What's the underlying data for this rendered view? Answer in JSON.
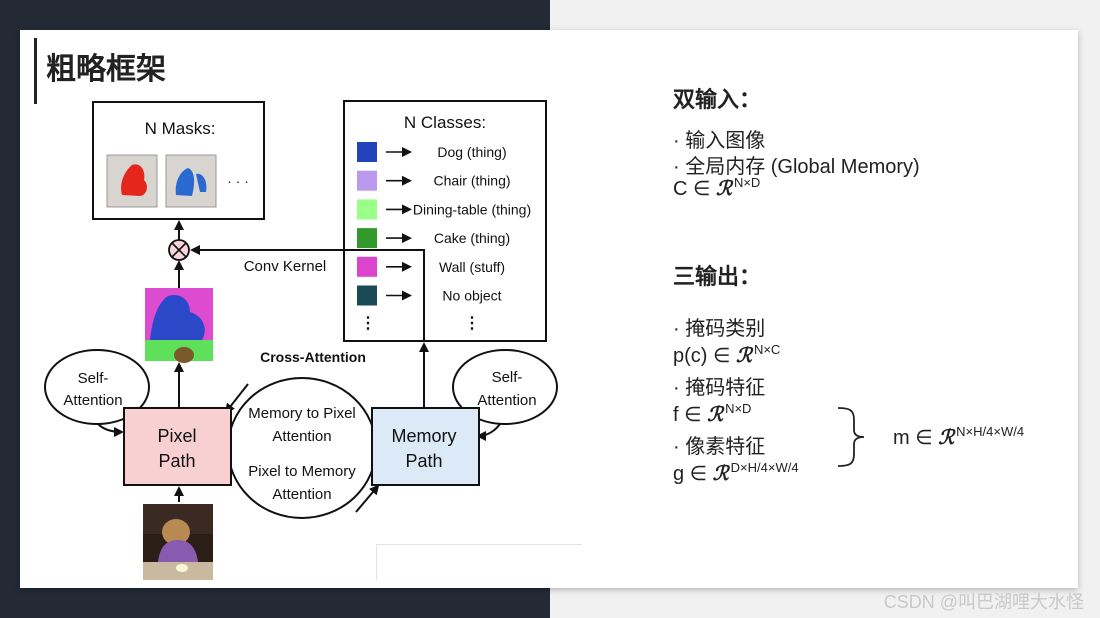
{
  "slide": {
    "title": "粗略框架"
  },
  "diagram": {
    "masks_title": "N Masks:",
    "masks_ellipsis": "· · ·",
    "classes_title": "N Classes:",
    "classes": [
      {
        "label": "Dog (thing)",
        "color": "#2244bb"
      },
      {
        "label": "Chair (thing)",
        "color": "#bb99ee"
      },
      {
        "label": "Dining-table (thing)",
        "color": "#99ff88"
      },
      {
        "label": "Cake (thing)",
        "color": "#33992a"
      },
      {
        "label": "Wall (stuff)",
        "color": "#dd44cc"
      },
      {
        "label": "No object",
        "color": "#1a4a55"
      }
    ],
    "conv_kernel": "Conv Kernel",
    "cross_attention": "Cross-Attention",
    "self_attention_left_1": "Self-",
    "self_attention_left_2": "Attention",
    "self_attention_right_1": "Self-",
    "self_attention_right_2": "Attention",
    "pixel_path_1": "Pixel",
    "pixel_path_2": "Path",
    "memory_path_1": "Memory",
    "memory_path_2": "Path",
    "mem_to_pix_1": "Memory to Pixel",
    "mem_to_pix_2": "Attention",
    "pix_to_mem_1": "Pixel to Memory",
    "pix_to_mem_2": "Attention",
    "pixel_path_color": "#f8d0d2",
    "memory_path_color": "#dce9f6"
  },
  "inputs": {
    "heading": "双输入：",
    "item1": "· 输入图像",
    "item2": "· 全局内存 (Global Memory)",
    "c_prefix": "C ∈ ",
    "c_sup": "N×D"
  },
  "outputs": {
    "heading": "三输出：",
    "item1": "· 掩码类别",
    "p_prefix": "p(c) ∈ ",
    "p_sup": "N×C",
    "item2": "· 掩码特征",
    "f_prefix": "f ∈ ",
    "f_sup": "N×D",
    "item3": "· 像素特征",
    "g_prefix": "g ∈ ",
    "g_sup": "D×H/4×W/4",
    "m_prefix": "m ∈ ",
    "m_sup": "N×H/4×W/4",
    "script_r": "ℛ"
  },
  "watermark": "CSDN @叫巴湖哩大水怪"
}
